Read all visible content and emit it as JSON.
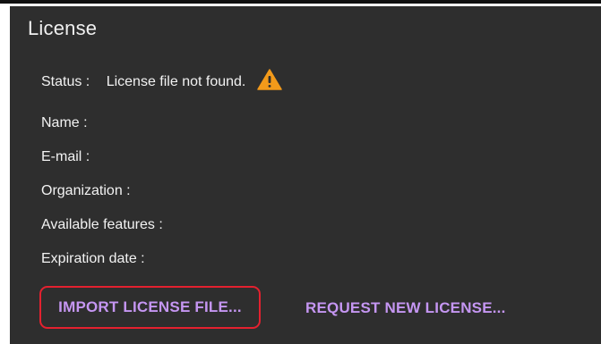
{
  "dialog": {
    "title": "License"
  },
  "status": {
    "label": "Status :",
    "value": "License file not found.",
    "icon": "warning-icon",
    "icon_color": "#f39a1a"
  },
  "fields": {
    "name_label": "Name :",
    "email_label": "E-mail :",
    "organization_label": "Organization :",
    "features_label": "Available features :",
    "expiration_label": "Expiration date :"
  },
  "actions": {
    "import_label": "IMPORT LICENSE FILE...",
    "request_label": "REQUEST NEW LICENSE...",
    "accent_color": "#c596f2",
    "highlight_color": "#e3212f"
  }
}
